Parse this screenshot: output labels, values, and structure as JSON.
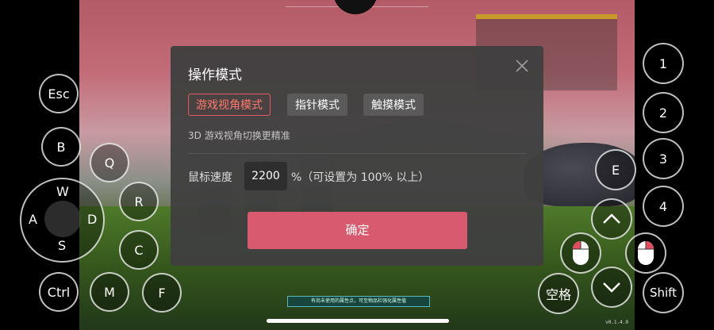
{
  "dialog": {
    "title": "操作模式",
    "modes": [
      {
        "label": "游戏视角模式",
        "active": true
      },
      {
        "label": "指针模式",
        "active": false
      },
      {
        "label": "触摸模式",
        "active": false
      }
    ],
    "hint": "3D 游戏视角切换更精准",
    "speed_label": "鼠标速度",
    "speed_value": "2200",
    "speed_unit": "%（可设置为 100% 以上）",
    "confirm_label": "确定"
  },
  "left_controls": {
    "esc": "Esc",
    "b": "B",
    "q": "Q",
    "r": "R",
    "c": "C",
    "ctrl": "Ctrl",
    "m": "M",
    "f": "F",
    "dpad": {
      "w": "W",
      "a": "A",
      "s": "S",
      "d": "D"
    }
  },
  "right_controls": {
    "n1": "1",
    "n2": "2",
    "n3": "3",
    "n4": "4",
    "e": "E",
    "space": "空格",
    "shift": "Shift"
  },
  "game": {
    "bottom_notice": "有尚未使用的属性点，可至物品栏强化属性值",
    "version": "v0.1.4.0"
  },
  "colors": {
    "accent": "#d75a6e",
    "active_mode": "#ff7a6e",
    "dialog_bg": "#404040"
  }
}
